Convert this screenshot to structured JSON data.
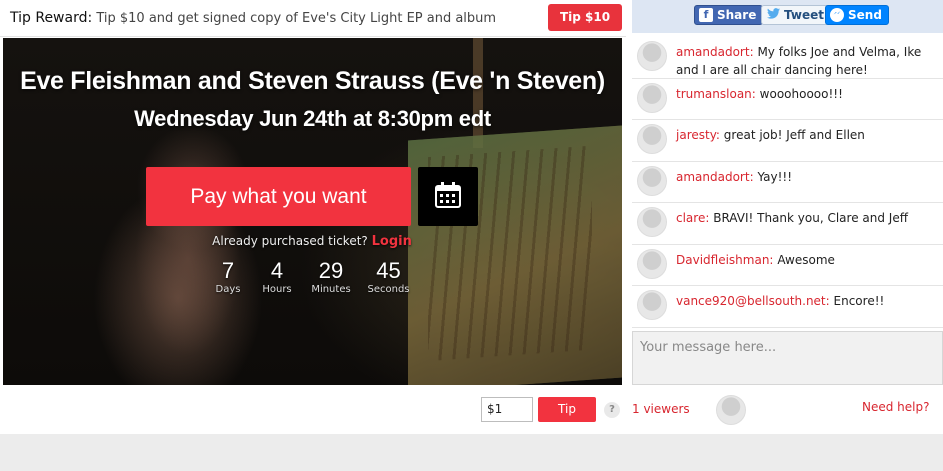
{
  "tip_reward": {
    "label": "Tip Reward:",
    "description": "Tip $10 and get signed copy of Eve's City Light EP and album",
    "button": "Tip $10"
  },
  "share": {
    "facebook": "Share",
    "twitter": "Tweet",
    "messenger": "Send"
  },
  "event": {
    "title": "Eve Fleishman and Steven Strauss (Eve 'n Steven)",
    "date": "Wednesday Jun 24th at 8:30pm edt",
    "pay_button": "Pay what you want",
    "calendar_icon": "calendar-icon",
    "purchased_text": "Already purchased ticket?",
    "login_link": "Login",
    "countdown": {
      "days": {
        "value": "7",
        "label": "Days"
      },
      "hours": {
        "value": "4",
        "label": "Hours"
      },
      "minutes": {
        "value": "29",
        "label": "Minutes"
      },
      "seconds": {
        "value": "45",
        "label": "Seconds"
      }
    }
  },
  "chat": {
    "messages": [
      {
        "user": "amandadort:",
        "text": "My folks Joe and Velma, Ike and I are all chair dancing here!"
      },
      {
        "user": "trumansloan:",
        "text": "wooohoooo!!!"
      },
      {
        "user": "jaresty:",
        "text": "great job! Jeff and Ellen"
      },
      {
        "user": "amandadort:",
        "text": "Yay!!!"
      },
      {
        "user": "clare:",
        "text": "BRAVI! Thank you, Clare and Jeff"
      },
      {
        "user": "Davidfleishman:",
        "text": "Awesome"
      },
      {
        "user": "vance920@bellsouth.net:",
        "text": "Encore!!"
      }
    ],
    "input_placeholder": "Your message here..."
  },
  "bottom": {
    "amount_value": "$1",
    "tip_button": "Tip",
    "help_icon": "?",
    "viewers": "1 viewers",
    "need_help": "Need help?"
  },
  "colors": {
    "accent": "#f2333f",
    "link": "#d8262f",
    "share_bar": "#dde6f3"
  }
}
